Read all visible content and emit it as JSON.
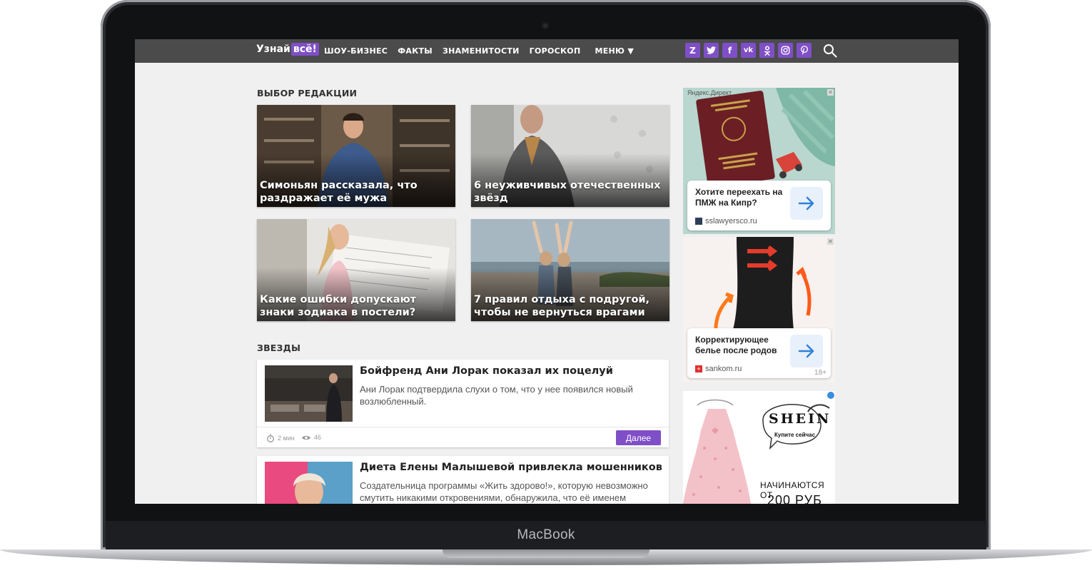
{
  "device": {
    "brand": "MacBook"
  },
  "site": {
    "logo": {
      "part1": "Узнай",
      "part2": "всё!"
    },
    "nav": [
      "ШОУ-БИЗНЕС",
      "ФАКТЫ",
      "ЗНАМЕНИТОСТИ",
      "ГОРОСКОП",
      "МЕНЮ ▼"
    ],
    "socials": [
      "zen-icon",
      "twitter-icon",
      "facebook-icon",
      "vk-icon",
      "odnoklassniki-icon",
      "instagram-icon",
      "pinterest-icon"
    ]
  },
  "editors_choice": {
    "title": "ВЫБОР РЕДАКЦИИ",
    "cards": [
      {
        "caption": "Симоньян рассказала, что раздражает её мужа"
      },
      {
        "caption": "6 неуживчивых отечественных звёзд"
      },
      {
        "caption": "Какие ошибки допускают знаки зодиака в постели?"
      },
      {
        "caption": "7 правил отдыха с подругой, чтобы не вернуться врагами"
      }
    ]
  },
  "stars": {
    "title": "ЗВЕЗДЫ",
    "articles": [
      {
        "title": "Бойфренд Ани Лорак показал их поцелуй",
        "desc": "Ани Лорак подтвердила слухи о том, что у нее появился новый возлюбленный.",
        "read_time": "2 мин",
        "views": "46",
        "more": "Далее"
      },
      {
        "title": "Диета Елены Малышевой привлекла мошенников",
        "desc": "Создательница программы «Жить здорово!», которую невозможно смутить никакими откровениями, обнаружила, что её именем"
      }
    ]
  },
  "ads": [
    {
      "label": "Яндекс.Директ",
      "title": "Хотите переехать на ПМЖ на Кипр?",
      "url": "sslawyersco.ru",
      "close": "✕"
    },
    {
      "title": "Корректирующее белье после родов",
      "url": "sankom.ru",
      "age": "18+",
      "close": "✕"
    },
    {
      "brand": "SHEIN",
      "cta": "Купите сейчас",
      "price_line1": "НАЧИНАЮТСЯ ОТ",
      "price_line2": "200 РУБ"
    }
  ],
  "colors": {
    "accent": "#7f4fc7",
    "header": "#4b4b4b",
    "page_bg": "#f0f0f0"
  }
}
